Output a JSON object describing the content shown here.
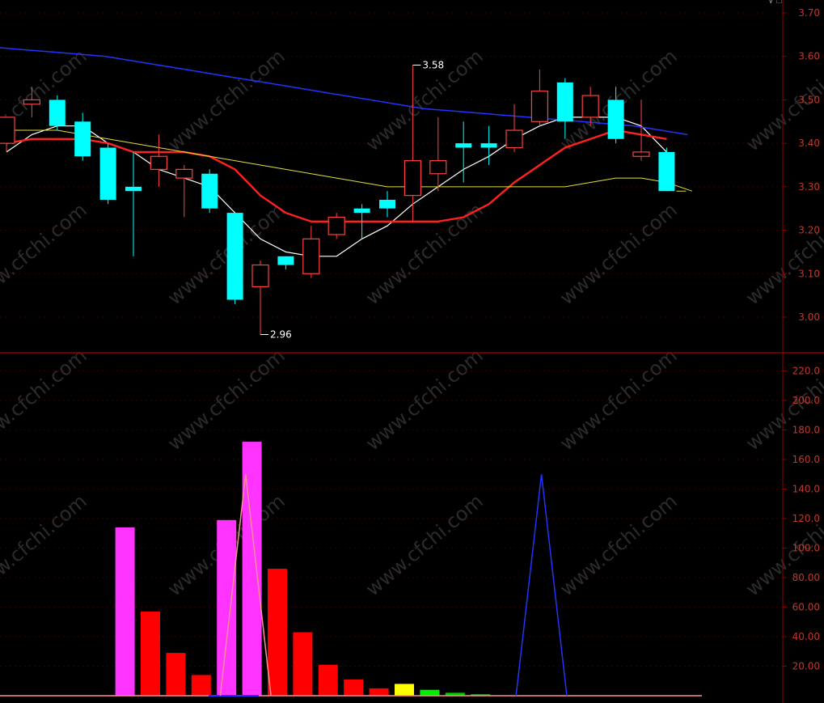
{
  "header": {
    "icons": [
      "chevron-down-icon",
      "window-icon"
    ]
  },
  "colors": {
    "background": "#000000",
    "frame": "#8b0000",
    "axis_text": "#c0392b",
    "up": "#ff4040",
    "down": "#00ffff",
    "ma5": "#ffffff",
    "ma10": "#ff2020",
    "ma20": "#e0e040",
    "ma60": "#2233ff",
    "watermark": "#2b2b2b"
  },
  "watermark_text": "www.cfchi.com",
  "chart_data": [
    {
      "type": "candlestick",
      "title": "",
      "ylim": [
        2.92,
        3.72
      ],
      "y_ticks": [
        "3.70",
        "3.60",
        "3.50",
        "3.40",
        "3.30",
        "3.20",
        "3.10",
        "3.00"
      ],
      "grid": "dashed horizontal",
      "annotations": [
        {
          "text": "3.58",
          "index": 16,
          "value": 3.58
        },
        {
          "text": "2.96",
          "index": 10,
          "value": 2.96
        }
      ],
      "candles": [
        {
          "open": 3.4,
          "high": 3.46,
          "low": 3.38,
          "close": 3.46
        },
        {
          "open": 3.49,
          "high": 3.53,
          "low": 3.46,
          "close": 3.5
        },
        {
          "open": 3.5,
          "high": 3.51,
          "low": 3.43,
          "close": 3.44
        },
        {
          "open": 3.45,
          "high": 3.47,
          "low": 3.36,
          "close": 3.37
        },
        {
          "open": 3.39,
          "high": 3.4,
          "low": 3.26,
          "close": 3.27
        },
        {
          "open": 3.3,
          "high": 3.38,
          "low": 3.14,
          "close": 3.29
        },
        {
          "open": 3.34,
          "high": 3.42,
          "low": 3.3,
          "close": 3.37
        },
        {
          "open": 3.32,
          "high": 3.35,
          "low": 3.23,
          "close": 3.34
        },
        {
          "open": 3.33,
          "high": 3.34,
          "low": 3.24,
          "close": 3.25
        },
        {
          "open": 3.24,
          "high": 3.24,
          "low": 3.03,
          "close": 3.04
        },
        {
          "open": 3.07,
          "high": 3.13,
          "low": 2.96,
          "close": 3.12
        },
        {
          "open": 3.14,
          "high": 3.14,
          "low": 3.11,
          "close": 3.12
        },
        {
          "open": 3.1,
          "high": 3.21,
          "low": 3.09,
          "close": 3.18
        },
        {
          "open": 3.19,
          "high": 3.24,
          "low": 3.18,
          "close": 3.23
        },
        {
          "open": 3.25,
          "high": 3.26,
          "low": 3.18,
          "close": 3.24
        },
        {
          "open": 3.27,
          "high": 3.29,
          "low": 3.23,
          "close": 3.25
        },
        {
          "open": 3.28,
          "high": 3.58,
          "low": 3.22,
          "close": 3.36
        },
        {
          "open": 3.33,
          "high": 3.46,
          "low": 3.29,
          "close": 3.36
        },
        {
          "open": 3.4,
          "high": 3.45,
          "low": 3.31,
          "close": 3.39
        },
        {
          "open": 3.4,
          "high": 3.44,
          "low": 3.35,
          "close": 3.39
        },
        {
          "open": 3.39,
          "high": 3.49,
          "low": 3.38,
          "close": 3.43
        },
        {
          "open": 3.45,
          "high": 3.57,
          "low": 3.44,
          "close": 3.52
        },
        {
          "open": 3.54,
          "high": 3.55,
          "low": 3.41,
          "close": 3.45
        },
        {
          "open": 3.46,
          "high": 3.53,
          "low": 3.44,
          "close": 3.51
        },
        {
          "open": 3.5,
          "high": 3.53,
          "low": 3.4,
          "close": 3.41
        },
        {
          "open": 3.37,
          "high": 3.5,
          "low": 3.36,
          "close": 3.38
        },
        {
          "open": 3.38,
          "high": 3.39,
          "low": 3.29,
          "close": 3.29
        }
      ],
      "series": [
        {
          "values": [
            3.38,
            3.42,
            3.44,
            3.44,
            3.4,
            3.38,
            3.34,
            3.32,
            3.3,
            3.24,
            3.18,
            3.15,
            3.14,
            3.14,
            3.18,
            3.21,
            3.26,
            3.3,
            3.34,
            3.37,
            3.41,
            3.44,
            3.46,
            3.46,
            3.46,
            3.44,
            3.38
          ]
        },
        {
          "values": [
            3.4,
            3.41,
            3.41,
            3.41,
            3.4,
            3.38,
            3.38,
            3.38,
            3.37,
            3.34,
            3.28,
            3.24,
            3.22,
            3.22,
            3.22,
            3.22,
            3.22,
            3.22,
            3.23,
            3.26,
            3.31,
            3.35,
            3.39,
            3.41,
            3.43,
            3.42,
            3.41
          ]
        },
        {
          "values": [
            3.43,
            3.43,
            3.43,
            3.42,
            3.41,
            3.4,
            3.39,
            3.38,
            3.37,
            3.36,
            3.35,
            3.34,
            3.33,
            3.32,
            3.31,
            3.3,
            3.3,
            3.3,
            3.3,
            3.3,
            3.3,
            3.3,
            3.3,
            3.31,
            3.32,
            3.32,
            3.31,
            3.29
          ]
        },
        {
          "values": [
            3.62,
            3.615,
            3.61,
            3.605,
            3.6,
            3.59,
            3.58,
            3.57,
            3.56,
            3.55,
            3.54,
            3.53,
            3.52,
            3.51,
            3.5,
            3.49,
            3.48,
            3.475,
            3.47,
            3.465,
            3.46,
            3.455,
            3.45,
            3.445,
            3.44,
            3.43,
            3.42
          ]
        }
      ]
    },
    {
      "type": "bar",
      "title": "",
      "ylim": [
        0,
        230
      ],
      "y_ticks": [
        "220.0",
        "200.0",
        "180.0",
        "160.0",
        "140.0",
        "120.0",
        "100.0",
        "80.00",
        "60.00",
        "40.00",
        "20.00"
      ],
      "grid": "dashed horizontal",
      "bars": [
        {
          "index": 4,
          "value": 114,
          "color": "#ff33ff"
        },
        {
          "index": 5,
          "value": 57,
          "color": "#ff0000"
        },
        {
          "index": 6,
          "value": 29,
          "color": "#ff0000"
        },
        {
          "index": 7,
          "value": 14,
          "color": "#ff0000"
        },
        {
          "index": 8,
          "value": 119,
          "color": "#ff33ff"
        },
        {
          "index": 9,
          "value": 172,
          "color": "#ff33ff"
        },
        {
          "index": 10,
          "value": 86,
          "color": "#ff0000"
        },
        {
          "index": 11,
          "value": 43,
          "color": "#ff0000"
        },
        {
          "index": 12,
          "value": 21,
          "color": "#ff0000"
        },
        {
          "index": 13,
          "value": 11,
          "color": "#ff0000"
        },
        {
          "index": 14,
          "value": 5,
          "color": "#ff0000"
        },
        {
          "index": 15,
          "value": 8,
          "color": "#ffff00"
        },
        {
          "index": 16,
          "value": 4,
          "color": "#00ee00"
        },
        {
          "index": 17,
          "value": 2,
          "color": "#00cc00"
        },
        {
          "index": 18,
          "value": 1,
          "color": "#33aa33"
        }
      ],
      "lines": [
        {
          "color": "#ff9090",
          "points": [
            [
              7.75,
              0
            ],
            [
              8.75,
              150
            ],
            [
              9.75,
              0
            ]
          ]
        },
        {
          "color": "#2233ff",
          "points": [
            [
              19.4,
              0
            ],
            [
              20.4,
              150
            ],
            [
              21.4,
              0
            ]
          ]
        }
      ]
    }
  ]
}
